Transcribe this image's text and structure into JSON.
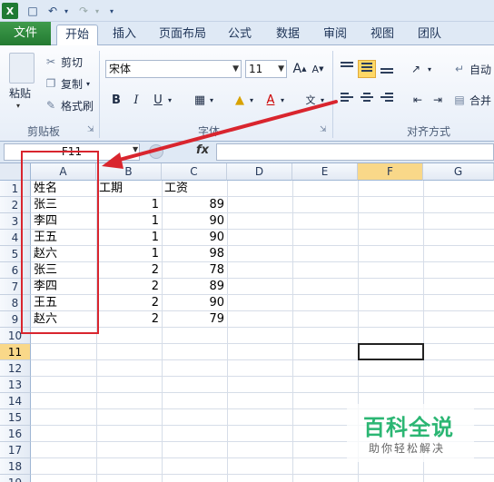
{
  "tabs": [
    {
      "label": "文件"
    },
    {
      "label": "开始"
    },
    {
      "label": "插入"
    },
    {
      "label": "页面布局"
    },
    {
      "label": "公式"
    },
    {
      "label": "数据"
    },
    {
      "label": "审阅"
    },
    {
      "label": "视图"
    },
    {
      "label": "团队"
    }
  ],
  "clipboard": {
    "paste": "粘贴",
    "cut": "剪切",
    "copy": "复制",
    "format_painter": "格式刷",
    "group_label": "剪贴板"
  },
  "font": {
    "name": "宋体",
    "size": "11",
    "bold": "B",
    "italic": "I",
    "underline": "U",
    "group_label": "字体"
  },
  "alignment": {
    "wrap_text": "自动",
    "merge": "合并",
    "group_label": "对齐方式"
  },
  "formula_bar": {
    "name_box": "F11",
    "fx": "fx",
    "value": ""
  },
  "columns": [
    "A",
    "B",
    "C",
    "D",
    "E",
    "F",
    "G"
  ],
  "rows": [
    "1",
    "2",
    "3",
    "4",
    "5",
    "6",
    "7",
    "8",
    "9",
    "10",
    "11",
    "12",
    "13",
    "14",
    "15",
    "16",
    "17",
    "18",
    "19"
  ],
  "cells": [
    {
      "a": "姓名",
      "b": "工期",
      "c": "工资"
    },
    {
      "a": "张三",
      "b": "1",
      "c": "89"
    },
    {
      "a": "李四",
      "b": "1",
      "c": "90"
    },
    {
      "a": "王五",
      "b": "1",
      "c": "90"
    },
    {
      "a": "赵六",
      "b": "1",
      "c": "98"
    },
    {
      "a": "张三",
      "b": "2",
      "c": "78"
    },
    {
      "a": "李四",
      "b": "2",
      "c": "89"
    },
    {
      "a": "王五",
      "b": "2",
      "c": "90"
    },
    {
      "a": "赵六",
      "b": "2",
      "c": "79"
    }
  ],
  "selected_row": "11",
  "watermark": {
    "title": "百科全说",
    "subtitle": "助你轻松解决"
  },
  "colors": {
    "file_tab": "#237a31",
    "annotation": "#d9252e",
    "watermark": "#2bb673"
  }
}
